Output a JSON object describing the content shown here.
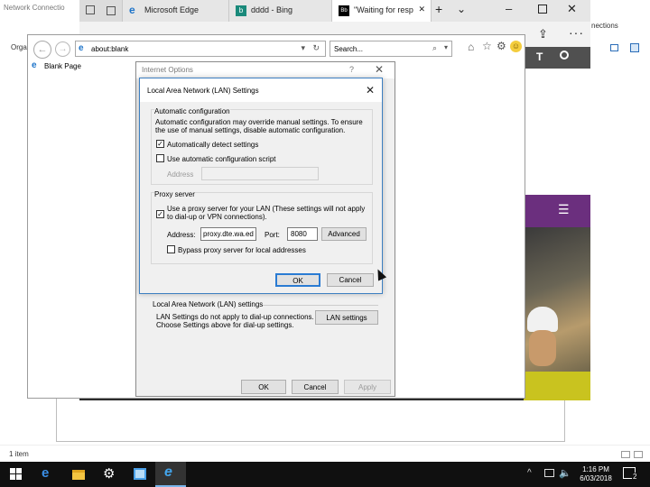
{
  "explorer": {
    "title": "Network Connectio",
    "organize": "Orga",
    "connections_tail": "nections",
    "status": "1 item"
  },
  "edge": {
    "tabs": [
      {
        "label": "",
        "icon": "window-icon"
      },
      {
        "label": "Microsoft Edge",
        "icon": "edge-logo-icon"
      },
      {
        "label": "dddd - Bing",
        "icon": "bing-logo-icon"
      },
      {
        "label": "\"Waiting for resp",
        "icon": "blackboard-icon",
        "active": true
      }
    ],
    "new_tab": "+",
    "site": {
      "header_letter": "T"
    }
  },
  "ie": {
    "address": "about:blank",
    "search_placeholder": "Search...",
    "tab_label": "Blank Page"
  },
  "internet_options": {
    "title": "Internet Options",
    "help": "?",
    "lan_legend": "Local Area Network (LAN) settings",
    "lan_description": "LAN Settings do not apply to dial-up connections. Choose Settings above for dial-up settings.",
    "lan_button": "LAN settings",
    "ok": "OK",
    "cancel": "Cancel",
    "apply": "Apply"
  },
  "lan_settings": {
    "title": "Local Area Network (LAN) Settings",
    "auto_legend": "Automatic configuration",
    "auto_description": "Automatic configuration may override manual settings.  To ensure the use of manual settings, disable automatic configuration.",
    "auto_detect": {
      "label": "Automatically detect settings",
      "checked": true
    },
    "auto_script": {
      "label": "Use automatic configuration script",
      "checked": false
    },
    "auto_address_label": "Address",
    "auto_address_value": "",
    "proxy_legend": "Proxy server",
    "use_proxy": {
      "label": "Use a proxy server for your LAN (These settings will not apply to dial-up or VPN connections).",
      "checked": true
    },
    "address_label": "Address:",
    "address_value": "proxy.dte.wa.ed",
    "port_label": "Port:",
    "port_value": "8080",
    "advanced": "Advanced",
    "bypass": {
      "label": "Bypass proxy server for local addresses",
      "checked": false
    },
    "ok": "OK",
    "cancel": "Cancel"
  },
  "taskbar": {
    "time": "1:16 PM",
    "date": "6/03/2018",
    "notifications": "2"
  },
  "colors": {
    "taskbar": "#101010",
    "dialog": "#f0f0f0",
    "accent": "#2a7bd3",
    "site_purple": "#6b2f7e"
  }
}
